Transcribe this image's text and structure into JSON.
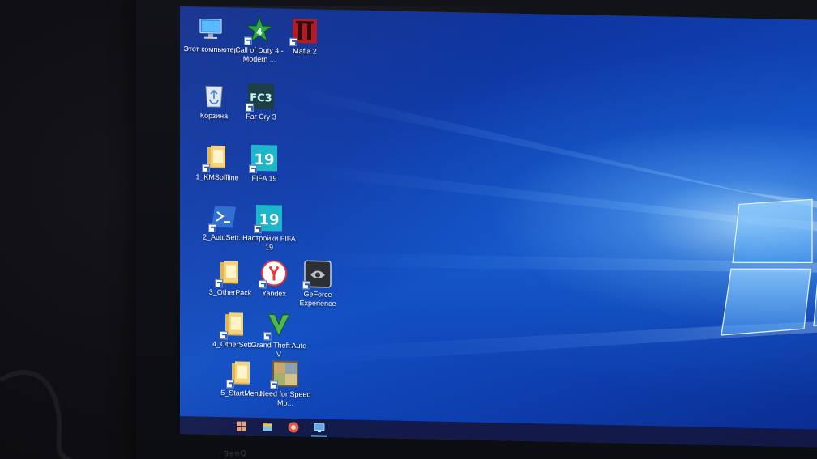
{
  "desktop": {
    "icons": [
      {
        "label": "Этот компьютер",
        "icon": "this-pc-icon",
        "shortcut": false
      },
      {
        "label": "Call of Duty 4 - Modern ...",
        "icon": "call-of-duty-4-icon",
        "shortcut": true
      },
      {
        "label": "Mafia 2",
        "icon": "mafia-2-icon",
        "shortcut": true
      },
      {
        "label": "Корзина",
        "icon": "recycle-bin-icon",
        "shortcut": false
      },
      {
        "label": "Far Cry 3",
        "icon": "far-cry-3-icon",
        "shortcut": true
      },
      {
        "label": "1_KMSoffline",
        "icon": "folder-icon",
        "shortcut": true
      },
      {
        "label": "FIFA 19",
        "icon": "fifa-19-icon",
        "shortcut": true
      },
      {
        "label": "2_AutoSett...",
        "icon": "powershell-icon",
        "shortcut": true
      },
      {
        "label": "Настройки FIFA 19",
        "icon": "fifa-19-settings-icon",
        "shortcut": true
      },
      {
        "label": "3_OtherPack",
        "icon": "folder-icon",
        "shortcut": true
      },
      {
        "label": "Yandex",
        "icon": "yandex-browser-icon",
        "shortcut": true
      },
      {
        "label": "GeForce Experience",
        "icon": "geforce-experience-icon",
        "shortcut": true
      },
      {
        "label": "4_OtherSett...",
        "icon": "folder-icon",
        "shortcut": true
      },
      {
        "label": "Grand Theft Auto V",
        "icon": "gta-v-icon",
        "shortcut": true
      },
      {
        "label": "5_StartMenu",
        "icon": "folder-icon",
        "shortcut": true
      },
      {
        "label": "Need for Speed Mo...",
        "icon": "need-for-speed-icon",
        "shortcut": true
      }
    ]
  },
  "taskbar": {
    "items": [
      {
        "icon": "windows-start-icon"
      },
      {
        "icon": "file-explorer-icon"
      },
      {
        "icon": "yandex-browser-icon"
      },
      {
        "icon": "monitor-app-icon",
        "active": true
      }
    ]
  },
  "bezel": {
    "brand": "BenQ"
  },
  "colors": {
    "wallpaper_dark": "#0d2a8a",
    "wallpaper_light": "#aedcff",
    "taskbar": "#14163c"
  }
}
